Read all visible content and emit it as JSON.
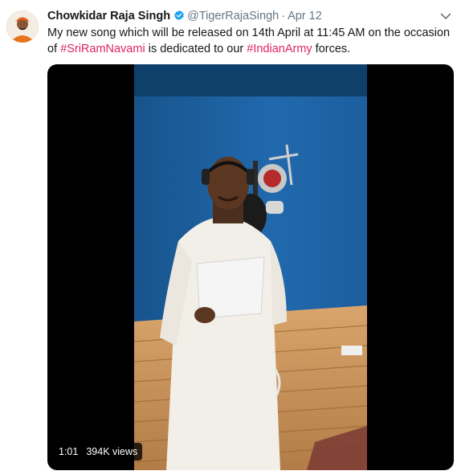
{
  "tweet": {
    "author_name": "Chowkidar Raja Singh",
    "handle": "@TigerRajaSingh",
    "separator": "·",
    "date": "Apr 12",
    "text_part1": "My new song which will be released on 14th April at 11:45 AM on the occasion of ",
    "hashtag1": "#SriRamNavami",
    "text_part2": " is dedicated to our ",
    "hashtag2": "#IndianArmy",
    "text_part3": " forces."
  },
  "video": {
    "duration": "1:01",
    "views": "394K views"
  },
  "colors": {
    "hashtag": "#e0245e",
    "verified": "#1da1f2",
    "muted_text": "#657786",
    "studio_wall": "#1f5f9c"
  },
  "icons": {
    "verified": "verified-badge-icon",
    "menu": "chevron-down-icon"
  }
}
